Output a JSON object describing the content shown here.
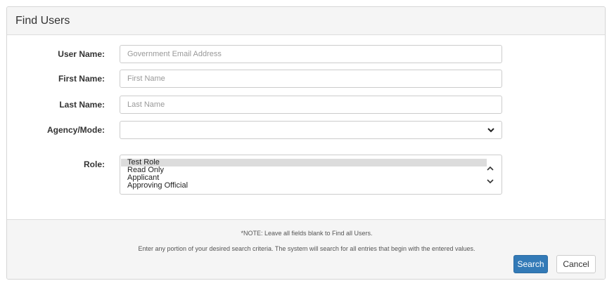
{
  "panel": {
    "title": "Find Users"
  },
  "form": {
    "user_name": {
      "label": "User Name:",
      "value": "",
      "placeholder": "Government Email Address"
    },
    "first_name": {
      "label": "First Name:",
      "value": "",
      "placeholder": "First Name"
    },
    "last_name": {
      "label": "Last Name:",
      "value": "",
      "placeholder": "Last Name"
    },
    "agency_mode": {
      "label": "Agency/Mode:",
      "selected": ""
    },
    "role": {
      "label": "Role:",
      "options": [
        "Test Role",
        "Read Only",
        "Applicant",
        "Approving Official"
      ],
      "selected_index": 0
    }
  },
  "footer": {
    "note": "*NOTE: Leave all fields blank to Find all Users.",
    "instructions": "Enter any portion of your desired search criteria. The system will search for all entries that begin with the entered values.",
    "search_label": "Search",
    "cancel_label": "Cancel"
  },
  "icons": {
    "agency_dropdown": "chevron-down-icon",
    "role_scroll_up": "chevron-up-icon",
    "role_scroll_down": "chevron-down-icon"
  },
  "colors": {
    "primary": "#337ab7",
    "panel_background": "#f5f5f5",
    "border": "#cccccc",
    "selected_option": "#dcdcdc"
  }
}
